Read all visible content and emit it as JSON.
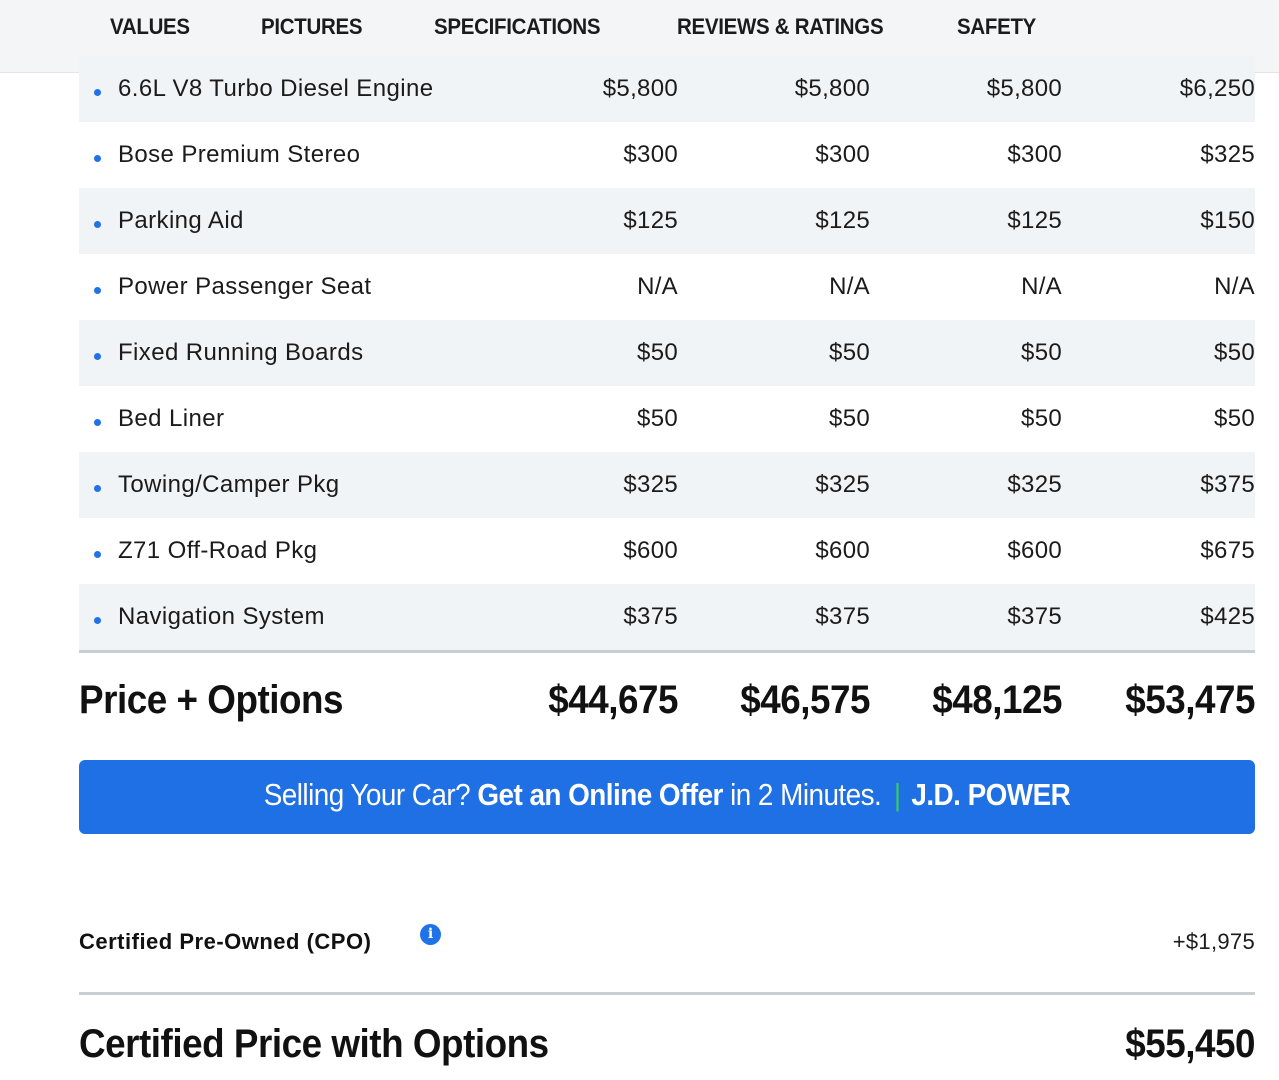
{
  "nav": {
    "tabs": [
      {
        "label": "VALUES",
        "active": true
      },
      {
        "label": "PICTURES",
        "active": false
      },
      {
        "label": "SPECIFICATIONS",
        "active": false
      },
      {
        "label": "REVIEWS & RATINGS",
        "active": false
      },
      {
        "label": "SAFETY",
        "active": false
      }
    ]
  },
  "options": [
    {
      "name": "6.6L V8 Turbo Diesel Engine",
      "values": [
        "$5,800",
        "$5,800",
        "$5,800",
        "$6,250"
      ]
    },
    {
      "name": "Bose Premium Stereo",
      "values": [
        "$300",
        "$300",
        "$300",
        "$325"
      ]
    },
    {
      "name": "Parking Aid",
      "values": [
        "$125",
        "$125",
        "$125",
        "$150"
      ]
    },
    {
      "name": "Power Passenger Seat",
      "values": [
        "N/A",
        "N/A",
        "N/A",
        "N/A"
      ]
    },
    {
      "name": "Fixed Running Boards",
      "values": [
        "$50",
        "$50",
        "$50",
        "$50"
      ]
    },
    {
      "name": "Bed Liner",
      "values": [
        "$50",
        "$50",
        "$50",
        "$50"
      ]
    },
    {
      "name": "Towing/Camper Pkg",
      "values": [
        "$325",
        "$325",
        "$325",
        "$375"
      ]
    },
    {
      "name": "Z71 Off-Road Pkg",
      "values": [
        "$600",
        "$600",
        "$600",
        "$675"
      ]
    },
    {
      "name": "Navigation System",
      "values": [
        "$375",
        "$375",
        "$375",
        "$425"
      ]
    }
  ],
  "price_options": {
    "label": "Price + Options",
    "values": [
      "$44,675",
      "$46,575",
      "$48,125",
      "$53,475"
    ]
  },
  "banner": {
    "part1": "Selling Your Car?",
    "part2": "Get an Online Offer",
    "part3": "in 2 Minutes.",
    "separator": "|",
    "brand": "J.D. POWER"
  },
  "cpo": {
    "label": "Certified Pre-Owned (CPO)",
    "info_icon": "info-icon",
    "value": "+$1,975"
  },
  "certified_total": {
    "label": "Certified Price with Options",
    "value": "$55,450"
  },
  "colors": {
    "accent_orange": "#f47b20",
    "accent_blue": "#1f6fe5",
    "separator_green": "#37c86a",
    "row_shade": "#f1f4f7"
  }
}
